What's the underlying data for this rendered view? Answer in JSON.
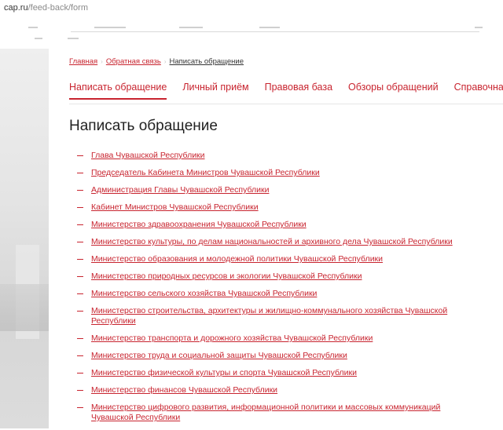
{
  "browser": {
    "url_host": "cap.ru",
    "url_path": "/feed-back/form"
  },
  "breadcrumb": {
    "home": "Главная",
    "feedback": "Обратная связь",
    "current": "Написать обращение"
  },
  "tabs": [
    {
      "label": "Написать обращение"
    },
    {
      "label": "Личный приём"
    },
    {
      "label": "Правовая база"
    },
    {
      "label": "Обзоры обращений"
    },
    {
      "label": "Справочная"
    }
  ],
  "page": {
    "title": "Написать обращение"
  },
  "organizations": [
    "Глава Чувашской Республики",
    "Председатель Кабинета Министров Чувашской Республики",
    "Администрация Главы Чувашской Республики",
    "Кабинет Министров Чувашской Республики",
    "Министерство здравоохранения Чувашской Республики",
    "Министерство культуры, по делам национальностей и архивного дела Чувашской Республики",
    "Министерство образования и молодежной политики Чувашской Республики",
    "Министерство природных ресурсов и экологии Чувашской Республики",
    "Министерство сельского хозяйства Чувашской Республики",
    "Министерство строительства, архитектуры и жилищно-коммунального хозяйства Чувашской Республики",
    "Министерство транспорта и дорожного хозяйства Чувашской Республики",
    "Министерство труда и социальной защиты Чувашской Республики",
    "Министерство физической культуры и спорта Чувашской Республики",
    "Министерство финансов Чувашской Республики",
    "Министерство цифрового развития, информационной политики и массовых коммуникаций Чувашской Республики"
  ],
  "colors": {
    "accent": "#c8242f"
  }
}
